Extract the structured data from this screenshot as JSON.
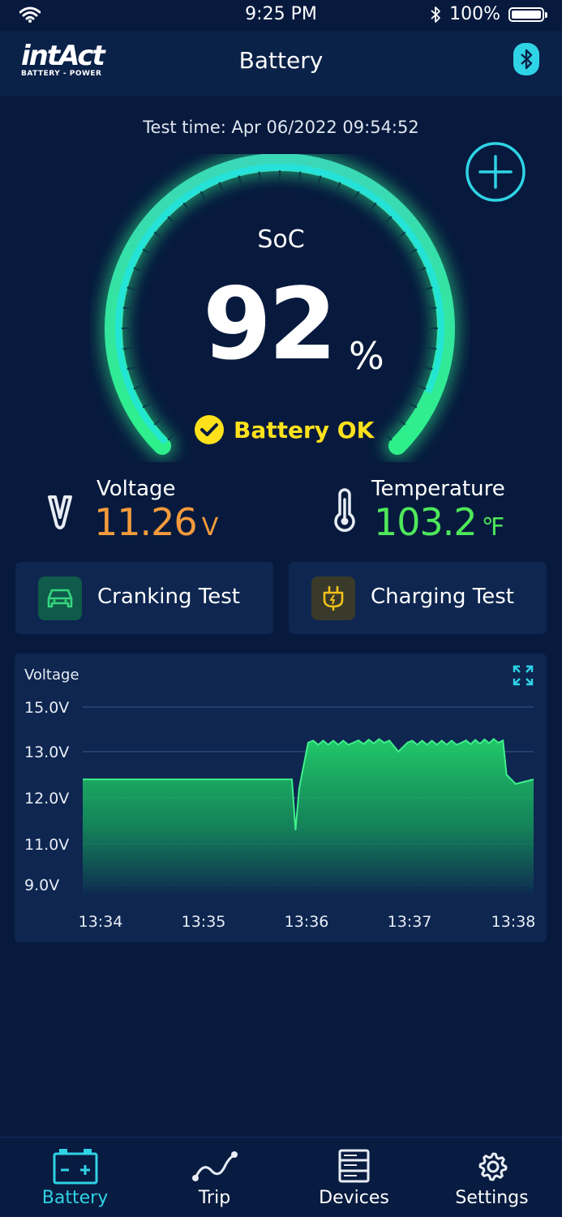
{
  "status_bar": {
    "time": "9:25 PM",
    "battery_text": "100%"
  },
  "header": {
    "logo_main": "intAct",
    "logo_sub": "BATTERY - POWER",
    "title": "Battery"
  },
  "test_time": "Test time: Apr 06/2022 09:54:52",
  "gauge": {
    "label": "SoC",
    "value": "92",
    "unit": "%",
    "status": "Battery OK",
    "fraction": 0.92
  },
  "voltage": {
    "label": "Voltage",
    "value": "11.26",
    "unit": "V",
    "color": "#f59b3c"
  },
  "temperature": {
    "label": "Temperature",
    "value": "103.2",
    "unit": "℉",
    "color": "#4ee85a"
  },
  "tests": [
    {
      "label": "Cranking Test",
      "icon": "car-icon"
    },
    {
      "label": "Charging Test",
      "icon": "plug-icon"
    }
  ],
  "chart_data": {
    "type": "area",
    "title": "Voltage",
    "y_ticks": [
      "15.0V",
      "13.0V",
      "12.0V",
      "11.0V",
      "9.0V"
    ],
    "x_ticks": [
      "13:34",
      "13:35",
      "13:36",
      "13:37",
      "13:38"
    ],
    "x": [
      "13:34:00",
      "13:35:00",
      "13:35:30",
      "13:35:56",
      "13:35:58",
      "13:36:00",
      "13:36:05",
      "13:36:30",
      "13:36:50",
      "13:36:55",
      "13:37:00",
      "13:37:30",
      "13:37:53",
      "13:37:55",
      "13:38:00",
      "13:38:10"
    ],
    "y": [
      12.4,
      12.4,
      12.4,
      12.4,
      11.3,
      12.2,
      13.4,
      13.4,
      13.5,
      13.0,
      13.4,
      13.4,
      13.5,
      12.5,
      12.3,
      12.4
    ],
    "color": "#22d16b"
  },
  "tabs": [
    {
      "label": "Battery",
      "icon": "battery-icon",
      "active": true
    },
    {
      "label": "Trip",
      "icon": "trip-icon",
      "active": false
    },
    {
      "label": "Devices",
      "icon": "devices-icon",
      "active": false
    },
    {
      "label": "Settings",
      "icon": "gear-icon",
      "active": false
    }
  ]
}
